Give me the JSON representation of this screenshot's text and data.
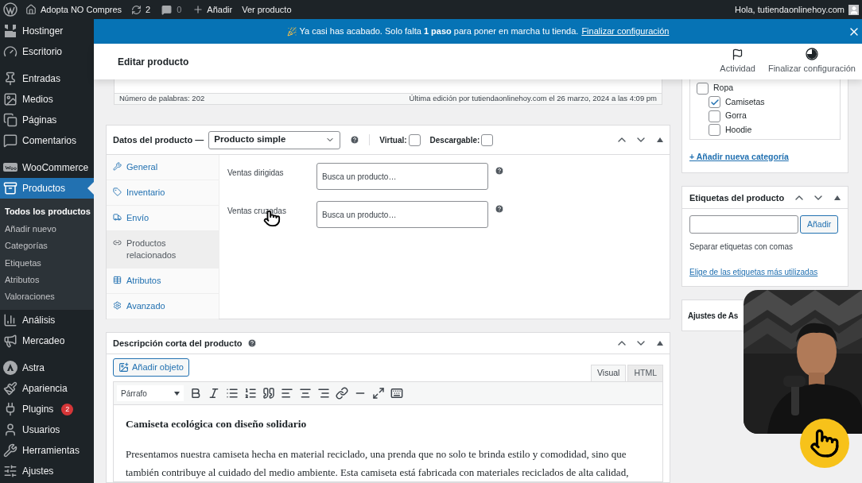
{
  "admin_bar": {
    "site": "Adopta NO Compres",
    "updates": "2",
    "comments": "0",
    "new": "Añadir",
    "view": "Ver producto",
    "greeting": "Hola, tutiendaonlinehoy.com"
  },
  "sidebar": {
    "items": [
      {
        "label": "Hostinger",
        "selected": false
      },
      {
        "label": "Escritorio",
        "selected": false
      },
      {
        "label": "Entradas",
        "selected": false
      },
      {
        "label": "Medios",
        "selected": false
      },
      {
        "label": "Páginas",
        "selected": false
      },
      {
        "label": "Comentarios",
        "selected": false
      },
      {
        "label": "WooCommerce",
        "selected": false
      },
      {
        "label": "Productos",
        "selected": true,
        "children": [
          {
            "label": "Todos los productos",
            "selected": true
          },
          {
            "label": "Añadir nuevo",
            "selected": false
          },
          {
            "label": "Categorías",
            "selected": false
          },
          {
            "label": "Etiquetas",
            "selected": false
          },
          {
            "label": "Atributos",
            "selected": false
          },
          {
            "label": "Valoraciones",
            "selected": false
          }
        ]
      },
      {
        "label": "Análisis",
        "selected": false
      },
      {
        "label": "Mercadeo",
        "selected": false
      },
      {
        "label": "Astra",
        "selected": false
      },
      {
        "label": "Apariencia",
        "selected": false
      },
      {
        "label": "Plugins",
        "selected": false,
        "badge": "2"
      },
      {
        "label": "Usuarios",
        "selected": false
      },
      {
        "label": "Herramientas",
        "selected": false
      },
      {
        "label": "Ajustes",
        "selected": false
      }
    ]
  },
  "notice": {
    "text": "Ya casi has acabado. Solo falta **1 paso** para poner en marcha tu tienda.",
    "link": "Finalizar configuración"
  },
  "header": {
    "title": "Editar producto",
    "actions": [
      "Actividad",
      "Finalizar configuración"
    ]
  },
  "editor_status": {
    "word_count": "Número de palabras: 202",
    "last_edit": "Última edición por tutiendaonlinehoy.com el 26 marzo, 2024 a las 4:09 pm"
  },
  "product_data": {
    "title": "Datos del producto —",
    "type": "Producto simple",
    "options": [
      {
        "label": "Virtual:",
        "checked": false
      },
      {
        "label": "Descargable:",
        "checked": false
      }
    ],
    "tabs": [
      {
        "label": "General",
        "selected": false
      },
      {
        "label": "Inventario",
        "selected": false
      },
      {
        "label": "Envío",
        "selected": false
      },
      {
        "label": "Productos relacionados",
        "selected": true
      },
      {
        "label": "Atributos",
        "selected": false
      },
      {
        "label": "Avanzado",
        "selected": false
      }
    ],
    "fields": [
      {
        "label": "Ventas dirigidas",
        "placeholder": "Busca un producto…"
      },
      {
        "label": "Ventas cruzadas",
        "placeholder": "Busca un producto…"
      }
    ]
  },
  "short_description": {
    "title": "Descripción corta del producto",
    "add_media": "Añadir objeto",
    "modes": [
      {
        "label": "Visual",
        "selected": true
      },
      {
        "label": "HTML",
        "selected": false
      }
    ],
    "format": "Párrafo",
    "heading": "Camiseta ecológica con diseño solidario",
    "paragraph": "Presentamos nuestra camiseta hecha en material reciclado, una prenda que no solo te brinda estilo y comodidad, sino que también contribuye al cuidado del medio ambiente. Esta camiseta está fabricada con materiales reciclados de alta calidad,"
  },
  "categories": {
    "items": [
      {
        "label": "Ropa",
        "checked": false,
        "children": [
          {
            "label": "Camisetas",
            "checked": true
          },
          {
            "label": "Gorra",
            "checked": false
          },
          {
            "label": "Hoodie",
            "checked": false
          }
        ]
      }
    ],
    "add_link": "+ Añadir nueva categoría"
  },
  "tags": {
    "title": "Etiquetas del producto",
    "button": "Añadir",
    "hint": "Separar etiquetas con comas",
    "link": "Elige de las etiquetas más utilizadas"
  },
  "settings_box": {
    "title": "Ajustes de As"
  }
}
